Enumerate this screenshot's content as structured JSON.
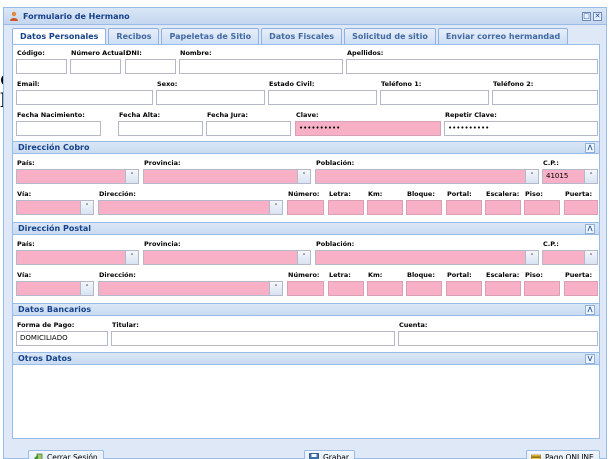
{
  "background_text": {
    "line1": "e",
    "line2": "l"
  },
  "window": {
    "title": "Formulario de Hermano"
  },
  "tabs": [
    "Datos Personales",
    "Recibos",
    "Papeletas de Sitio",
    "Datos Fiscales",
    "Solicitud de sitio",
    "Enviar correo hermandad"
  ],
  "personal": {
    "codigo_label": "Código:",
    "numero_label": "Número Actual:",
    "dni_label": "DNI:",
    "nombre_label": "Nombre:",
    "apellidos_label": "Apellidos:",
    "email_label": "Email:",
    "sexo_label": "Sexo:",
    "estado_label": "Estado Civil:",
    "tel1_label": "Teléfono 1:",
    "tel2_label": "Teléfono 2:",
    "nac_label": "Fecha Nacimiento:",
    "alta_label": "Fecha Alta:",
    "jura_label": "Fecha Jura:",
    "clave_label": "Clave:",
    "repetir_label": "Repetir Clave:",
    "clave_value": "••••••••••",
    "repetir_value": "••••••••••"
  },
  "cobro": {
    "title": "Dirección Cobro",
    "pais_label": "País:",
    "provincia_label": "Provincia:",
    "poblacion_label": "Población:",
    "cp_label": "C.P.:",
    "cp_value": "41015",
    "via_label": "Vía:",
    "direccion_label": "Dirección:",
    "numero_label": "Número:",
    "letra_label": "Letra:",
    "km_label": "Km:",
    "bloque_label": "Bloque:",
    "portal_label": "Portal:",
    "escalera_label": "Escalera:",
    "piso_label": "Piso:",
    "puerta_label": "Puerta:"
  },
  "postal": {
    "title": "Dirección Postal",
    "pais_label": "País:",
    "provincia_label": "Provincia:",
    "poblacion_label": "Población:",
    "cp_label": "C.P.:",
    "via_label": "Vía:",
    "direccion_label": "Dirección:",
    "numero_label": "Número:",
    "letra_label": "Letra:",
    "km_label": "Km:",
    "bloque_label": "Bloque:",
    "portal_label": "Portal:",
    "escalera_label": "Escalera:",
    "piso_label": "Piso:",
    "puerta_label": "Puerta:"
  },
  "bancarios": {
    "title": "Datos Bancarios",
    "forma_label": "Forma de Pago:",
    "forma_value": "DOMICILIADO",
    "titular_label": "Titular:",
    "cuenta_label": "Cuenta:"
  },
  "otros": {
    "title": "Otros Datos"
  },
  "footer": {
    "logout_label": "Cerrar Sesión",
    "save_label": "Grabar",
    "pay_label": "Pago ONLINE"
  }
}
